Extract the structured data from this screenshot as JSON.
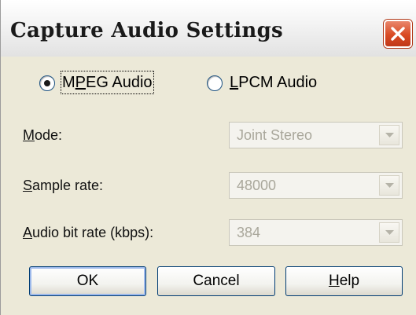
{
  "dialog": {
    "title": "Capture Audio Settings",
    "close_icon": "close-x-icon",
    "accent": "#d94a23"
  },
  "radios": [
    {
      "label": "MPEG Audio",
      "selected": true
    },
    {
      "label": "LPCM Audio",
      "selected": false
    }
  ],
  "fields": [
    {
      "label_access": "M",
      "label_rest": "ode:",
      "value": "Joint Stereo",
      "enabled": false
    },
    {
      "label_access": "S",
      "label_rest": "ample rate:",
      "value": "48000",
      "enabled": false
    },
    {
      "label_access": "A",
      "label_rest": "udio bit rate (kbps):",
      "value": "384",
      "enabled": false
    }
  ],
  "buttons": {
    "ok": "OK",
    "cancel": "Cancel",
    "help": "Help"
  },
  "icons": {
    "dropdown": "chevron-down-icon"
  }
}
